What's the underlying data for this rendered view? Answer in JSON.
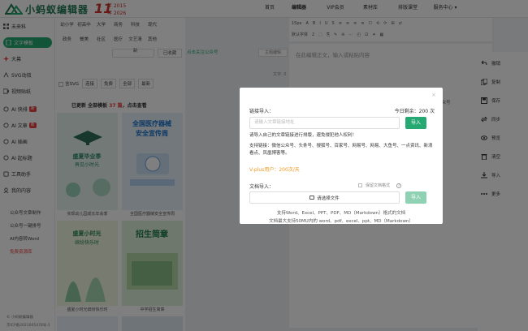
{
  "brand": {
    "logo_text": "小蚂蚁编辑器",
    "anniv_big": "11",
    "anniv_year1": "年 2015",
    "anniv_year2": "年 2026"
  },
  "nav": [
    "首页",
    "编辑器",
    "VIP会员",
    "素材库",
    "排版课堂",
    "服务中心 ▾"
  ],
  "sidebar": {
    "items": [
      {
        "label": "未来科",
        "icon": "grid-icon"
      },
      {
        "label": "文字模板",
        "icon": "file-icon"
      },
      {
        "label": "大幕",
        "icon": "sparkle-icon"
      },
      {
        "label": "SVG动效",
        "icon": "svg-icon"
      },
      {
        "label": "视频贴纸",
        "icon": "video-icon"
      },
      {
        "label": "AI 快排",
        "icon": "ai-icon",
        "badge": "新"
      },
      {
        "label": "AI 文章",
        "icon": "ai-icon",
        "badge": "新"
      },
      {
        "label": "AI 插画",
        "icon": "ai-icon"
      },
      {
        "label": "AI 起标题",
        "icon": "ai-icon"
      },
      {
        "label": "工具助手",
        "icon": "tool-icon"
      },
      {
        "label": "我的内容",
        "icon": "user-icon"
      }
    ],
    "links": [
      "公众号文章制作",
      "公众号一键排号",
      "AI内容转Word",
      "免费资源库"
    ],
    "footer": [
      "© 小蚂蚁编辑器",
      "京ICP备2021005478号-1"
    ]
  },
  "panel": {
    "categories_row1": [
      "幼小学",
      "初高中",
      "大学",
      "商务",
      "科技",
      "现代"
    ],
    "categories_row2": [
      "政务",
      "餐美",
      "社区",
      "医疗",
      "文艺清新",
      "其他"
    ],
    "search_placeholder": "搜索",
    "used_label": "已收藏",
    "filters": {
      "svg": "含SVG",
      "opt1": "连接",
      "opt2": "免费",
      "opt3": "全部",
      "opt4": "最新"
    },
    "update_prefix": "已更新 全部模板",
    "update_count": "37 篇",
    "update_suffix": "，点击查看",
    "cards": [
      {
        "title": "实现幼儿园成长",
        "caption": "实现幼儿园成长年会季"
      },
      {
        "title": "全国医疗器械安全宣传周",
        "caption": "全国医疗器械安全宣传周"
      },
      {
        "title": "盛夏小时光",
        "caption": "盛夏小时光缤纷快乐时"
      },
      {
        "title": "招生简章",
        "caption": "中学招生简章"
      },
      {
        "title": "",
        "caption": ""
      },
      {
        "title": "",
        "caption": ""
      }
    ]
  },
  "editor": {
    "toolbar_row1": [
      "15px",
      "A",
      "B",
      "I",
      "U",
      "S",
      "≡",
      "≡",
      "≡",
      "≡",
      "☐",
      "⟲",
      "⟳",
      "⊞",
      "⇄"
    ],
    "toolbar_row2": [
      "默认字体",
      "2",
      "⬚",
      "⎘",
      "✎",
      "⊘",
      "⋯",
      "◰",
      "⊡",
      "✦",
      "▦"
    ],
    "doc_hint": "在此编辑正文，输入或粘贴内容",
    "follow_tag_1": "点击关注公众号",
    "follow_tag_2": "点击关注公众号",
    "tag_btn": "主题编辑",
    "wordcount": "文字: 0"
  },
  "actions": [
    {
      "label": "撤销",
      "icon": "undo-icon"
    },
    {
      "label": "复制",
      "icon": "copy-icon"
    },
    {
      "label": "保存",
      "icon": "save-icon"
    },
    {
      "label": "同步",
      "icon": "sync-icon"
    },
    {
      "label": "预览",
      "icon": "eye-icon"
    },
    {
      "label": "清空",
      "icon": "trash-icon"
    },
    {
      "label": "导入",
      "icon": "import-icon"
    },
    {
      "label": "更多",
      "icon": "more-icon"
    }
  ],
  "modal": {
    "link_label": "链接导入：",
    "quota": "今日剩余：200 次",
    "link_placeholder": "请输入文章链接地址",
    "import_btn": "导入",
    "notice": "请导入自己的文章链接进行排版，避免侵犯他人权利！",
    "support": "支持链接：微信公众号、头条号、搜狐号、百家号、网易号、网易、大鱼号、一点资讯、新浪看点、凤凰博客等。",
    "vplus": "V-plus用户：200次/天",
    "doc_label": "文档导入：",
    "keep_format": "保留文档格式",
    "file_btn": "请选择文件",
    "doc_import_btn": "导入",
    "foot1": "支持Word、Excel、PPT、PDF、MD（Markdown）格式的文档",
    "foot2": "文档最大支持50MU内的 word、pdf、excel、ppt、MD（Markdown）",
    "colors": {
      "primary": "#25a871",
      "primary_light": "#8fd1b3",
      "warn": "#f09820"
    }
  }
}
